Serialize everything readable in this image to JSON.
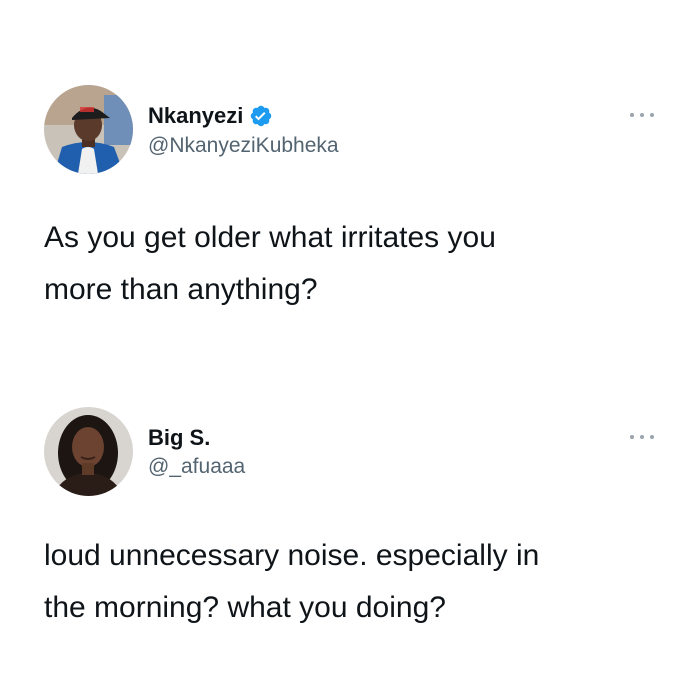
{
  "tweets": [
    {
      "display_name": "Nkanyezi",
      "handle": "@NkanyeziKubheka",
      "verified": true,
      "text_lines": [
        "As you get older what irritates you",
        "more than anything?"
      ],
      "avatar_icon": "avatar-man-cap",
      "more_icon": "more-options-icon"
    },
    {
      "display_name": "Big S.",
      "handle": "@_afuaaa",
      "verified": false,
      "text_lines": [
        "loud unnecessary noise. especially in",
        "the morning? what you doing?"
      ],
      "avatar_icon": "avatar-woman",
      "more_icon": "more-options-icon"
    }
  ],
  "colors": {
    "text": "#0f1419",
    "secondary": "#536471",
    "verified": "#1d9bf0",
    "more_dots": "#9aa4ad",
    "background": "#ffffff"
  }
}
